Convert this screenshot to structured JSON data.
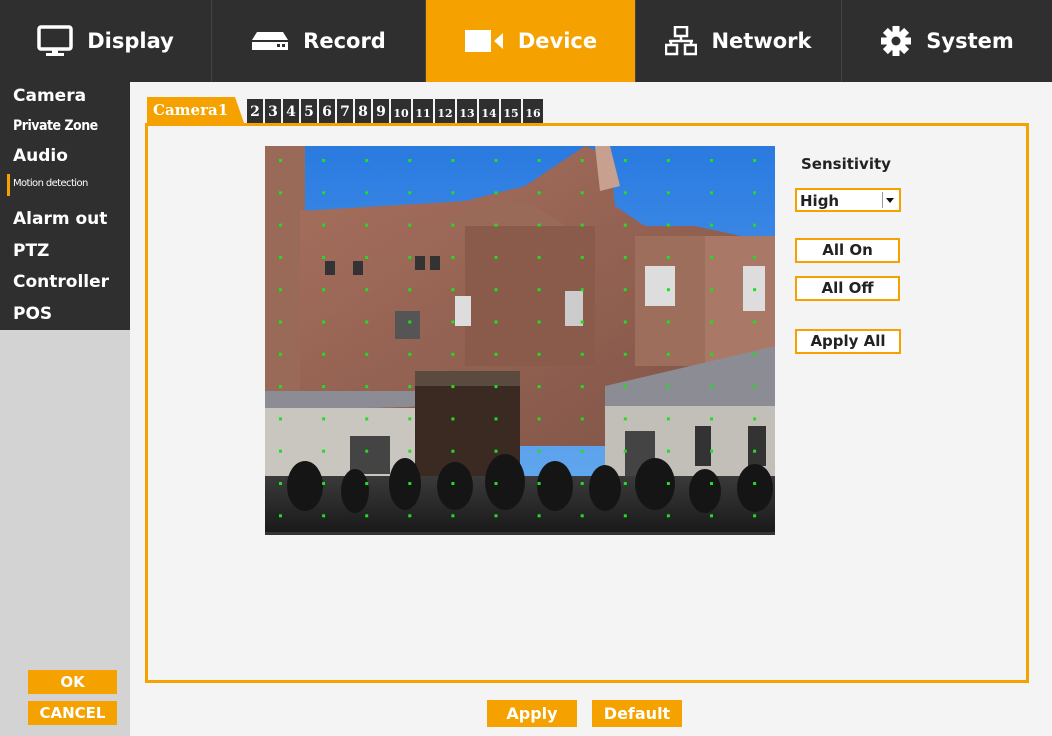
{
  "nav": {
    "items": [
      {
        "label": "Display",
        "icon": "monitor-icon"
      },
      {
        "label": "Record",
        "icon": "recorder-icon"
      },
      {
        "label": "Device",
        "icon": "camera-icon",
        "active": true
      },
      {
        "label": "Network",
        "icon": "network-icon"
      },
      {
        "label": "System",
        "icon": "gear-icon"
      }
    ]
  },
  "sidebar": {
    "items": [
      "Camera",
      "Private Zone",
      "Audio",
      "Motion detection",
      "Alarm out",
      "PTZ",
      "Controller",
      "POS"
    ],
    "active": "Motion detection",
    "ok_label": "OK",
    "cancel_label": "CANCEL"
  },
  "tabs": {
    "active_label": "Camera1",
    "numbers": [
      "2",
      "3",
      "4",
      "5",
      "6",
      "7",
      "8",
      "9",
      "10",
      "11",
      "12",
      "13",
      "14",
      "15",
      "16"
    ]
  },
  "motion": {
    "sensitivity_label": "Sensitivity",
    "sensitivity_value": "High",
    "all_on_label": "All On",
    "all_off_label": "All Off",
    "apply_all_label": "Apply All"
  },
  "footer": {
    "apply_label": "Apply",
    "default_label": "Default"
  },
  "colors": {
    "accent": "#f5a100",
    "dark": "#2f2f2f",
    "grid_dot": "#22dd22"
  }
}
